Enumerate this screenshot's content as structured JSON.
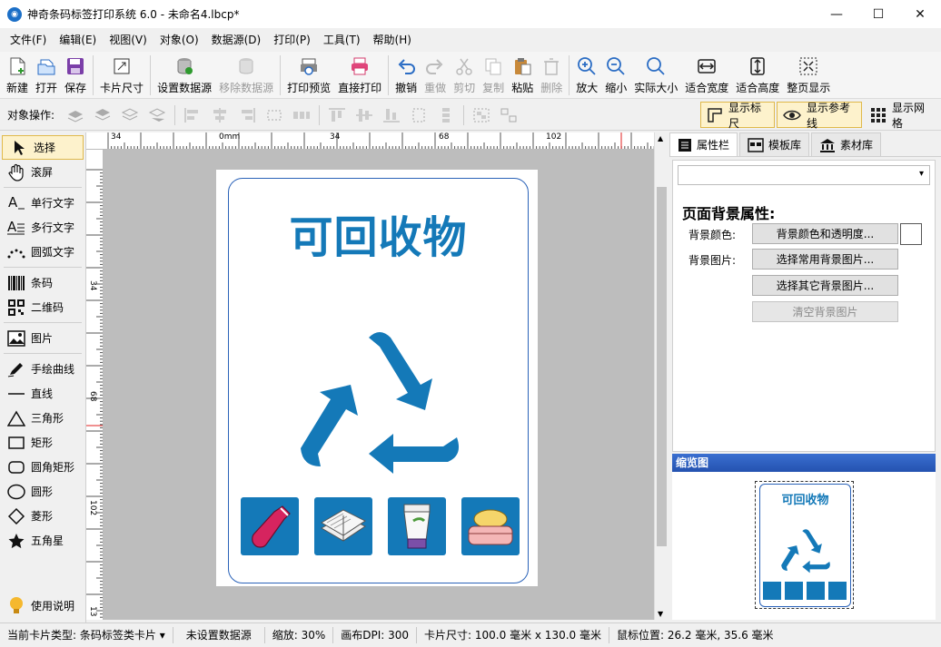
{
  "window": {
    "title": "神奇条码标签打印系统 6.0 - 未命名4.lbcp*",
    "minimize": "—",
    "maximize": "☐",
    "close": "✕"
  },
  "menu": [
    "文件(F)",
    "编辑(E)",
    "视图(V)",
    "对象(O)",
    "数据源(D)",
    "打印(P)",
    "工具(T)",
    "帮助(H)"
  ],
  "toolbar": {
    "new": "新建",
    "open": "打开",
    "save": "保存",
    "card_size": "卡片尺寸",
    "set_datasource": "设置数据源",
    "remove_datasource": "移除数据源",
    "print_preview": "打印预览",
    "direct_print": "直接打印",
    "undo": "撤销",
    "redo": "重做",
    "cut": "剪切",
    "copy": "复制",
    "paste": "粘贴",
    "delete": "删除",
    "zoom_in": "放大",
    "zoom_out": "缩小",
    "actual_size": "实际大小",
    "fit_width": "适合宽度",
    "fit_height": "适合高度",
    "fit_page": "整页显示"
  },
  "opsbar": {
    "label": "对象操作:",
    "show_ruler": "显示标尺",
    "show_guides": "显示参考线",
    "show_grid": "显示网格"
  },
  "tools": {
    "select": "选择",
    "scroll": "滚屏",
    "single_text": "单行文字",
    "multi_text": "多行文字",
    "arc_text": "圆弧文字",
    "barcode": "条码",
    "qrcode": "二维码",
    "image": "图片",
    "freehand": "手绘曲线",
    "line": "直线",
    "triangle": "三角形",
    "rect": "矩形",
    "round_rect": "圆角矩形",
    "circle": "圆形",
    "diamond": "菱形",
    "star": "五角星",
    "help": "使用说明"
  },
  "ruler": {
    "h_ticks": [
      "34",
      "0mm",
      "34",
      "68",
      "102"
    ],
    "v_ticks": [
      "34",
      "68",
      "102",
      "13"
    ]
  },
  "label": {
    "title": "可回收物"
  },
  "right_panel": {
    "tabs": [
      "属性栏",
      "模板库",
      "素材库"
    ],
    "heading": "页面背景属性:",
    "bg_color_label": "背景颜色:",
    "bg_color_button": "背景颜色和透明度...",
    "bg_image_label": "背景图片:",
    "common_bg_button": "选择常用背景图片...",
    "other_bg_button": "选择其它背景图片...",
    "clear_bg_button": "清空背景图片",
    "preview_title": "缩览图",
    "preview_label_title": "可回收物"
  },
  "status": {
    "card_type": "当前卡片类型: 条码标签类卡片",
    "datasource": "未设置数据源",
    "zoom": "缩放: 30%",
    "dpi": "画布DPI: 300",
    "card_size": "卡片尺寸: 100.0 毫米 x 130.0 毫米",
    "mouse_pos": "鼠标位置: 26.2 毫米, 35.6 毫米"
  },
  "colors": {
    "accent_blue": "#1479b8",
    "card_border": "#2a62b8",
    "toggle_bg": "#fdf2cc"
  }
}
